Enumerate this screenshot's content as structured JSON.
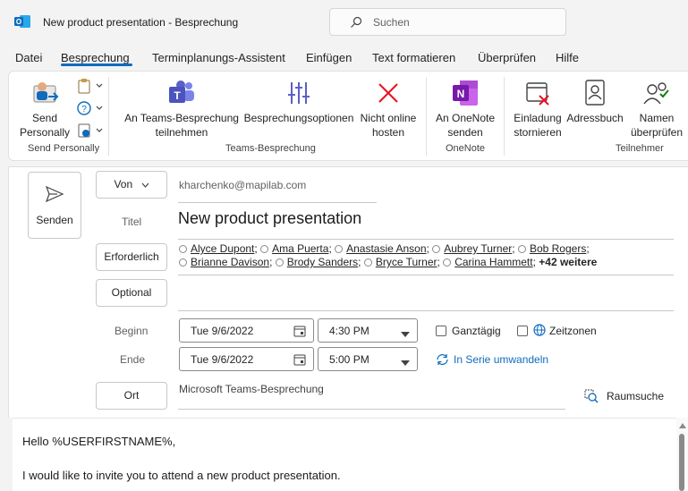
{
  "window": {
    "title": "New product presentation  -  Besprechung"
  },
  "search": {
    "placeholder": "Suchen"
  },
  "tabs": [
    {
      "label": "Datei"
    },
    {
      "label": "Besprechung"
    },
    {
      "label": "Terminplanungs-Assistent"
    },
    {
      "label": "Einfügen"
    },
    {
      "label": "Text formatieren"
    },
    {
      "label": "Überprüfen"
    },
    {
      "label": "Hilfe"
    }
  ],
  "ribbon": {
    "send_personally": {
      "line1": "Send",
      "line2": "Personally"
    },
    "teams_meeting": {
      "line1": "An Teams-Besprechung",
      "line2": "teilnehmen"
    },
    "meeting_options": {
      "line1": "Besprechungsoptionen"
    },
    "not_online": {
      "line1": "Nicht online",
      "line2": "hosten"
    },
    "onenote": {
      "line1": "An OneNote",
      "line2": "senden"
    },
    "cancel_invite": {
      "line1": "Einladung",
      "line2": "stornieren"
    },
    "address_book": {
      "line1": "Adressbuch"
    },
    "check_names": {
      "line1": "Namen",
      "line2": "überprüfen"
    },
    "groups": {
      "send_personally": "Send Personally",
      "teams": "Teams-Besprechung",
      "onenote": "OneNote",
      "attendees": "Teilnehmer"
    }
  },
  "form": {
    "send_label": "Senden",
    "from_label": "Von",
    "from_value": "kharchenko@mapilab.com",
    "subject_label": "Titel",
    "subject_value": "New product presentation",
    "required_label": "Erforderlich",
    "optional_label": "Optional",
    "required_attendees": [
      "Alyce Dupont",
      "Ama Puerta",
      "Anastasie Anson",
      "Aubrey Turner",
      "Bob Rogers",
      "Brianne Davison",
      "Brody Sanders",
      "Bryce Turner",
      "Carina Hammett"
    ],
    "more_attendees": "+42 weitere",
    "start_label": "Beginn",
    "start_date": "Tue 9/6/2022",
    "start_time": "4:30 PM",
    "end_label": "Ende",
    "end_date": "Tue 9/6/2022",
    "end_time": "5:00 PM",
    "all_day_label": "Ganztägig",
    "all_day_checked": false,
    "timezones_label": "Zeitzonen",
    "timezones_checked": false,
    "recurring_label": "In Serie umwandeln",
    "location_label": "Ort",
    "location_value": "Microsoft Teams-Besprechung",
    "room_finder_label": "Raumsuche"
  },
  "body": {
    "line1": "Hello %USERFIRSTNAME%,",
    "line2": "I would like to invite you to attend a new product presentation."
  },
  "colors": {
    "accent": "#0f6cbd",
    "teams": "#5b5fc7",
    "onenote": "#7719aa",
    "red": "#e81123"
  }
}
